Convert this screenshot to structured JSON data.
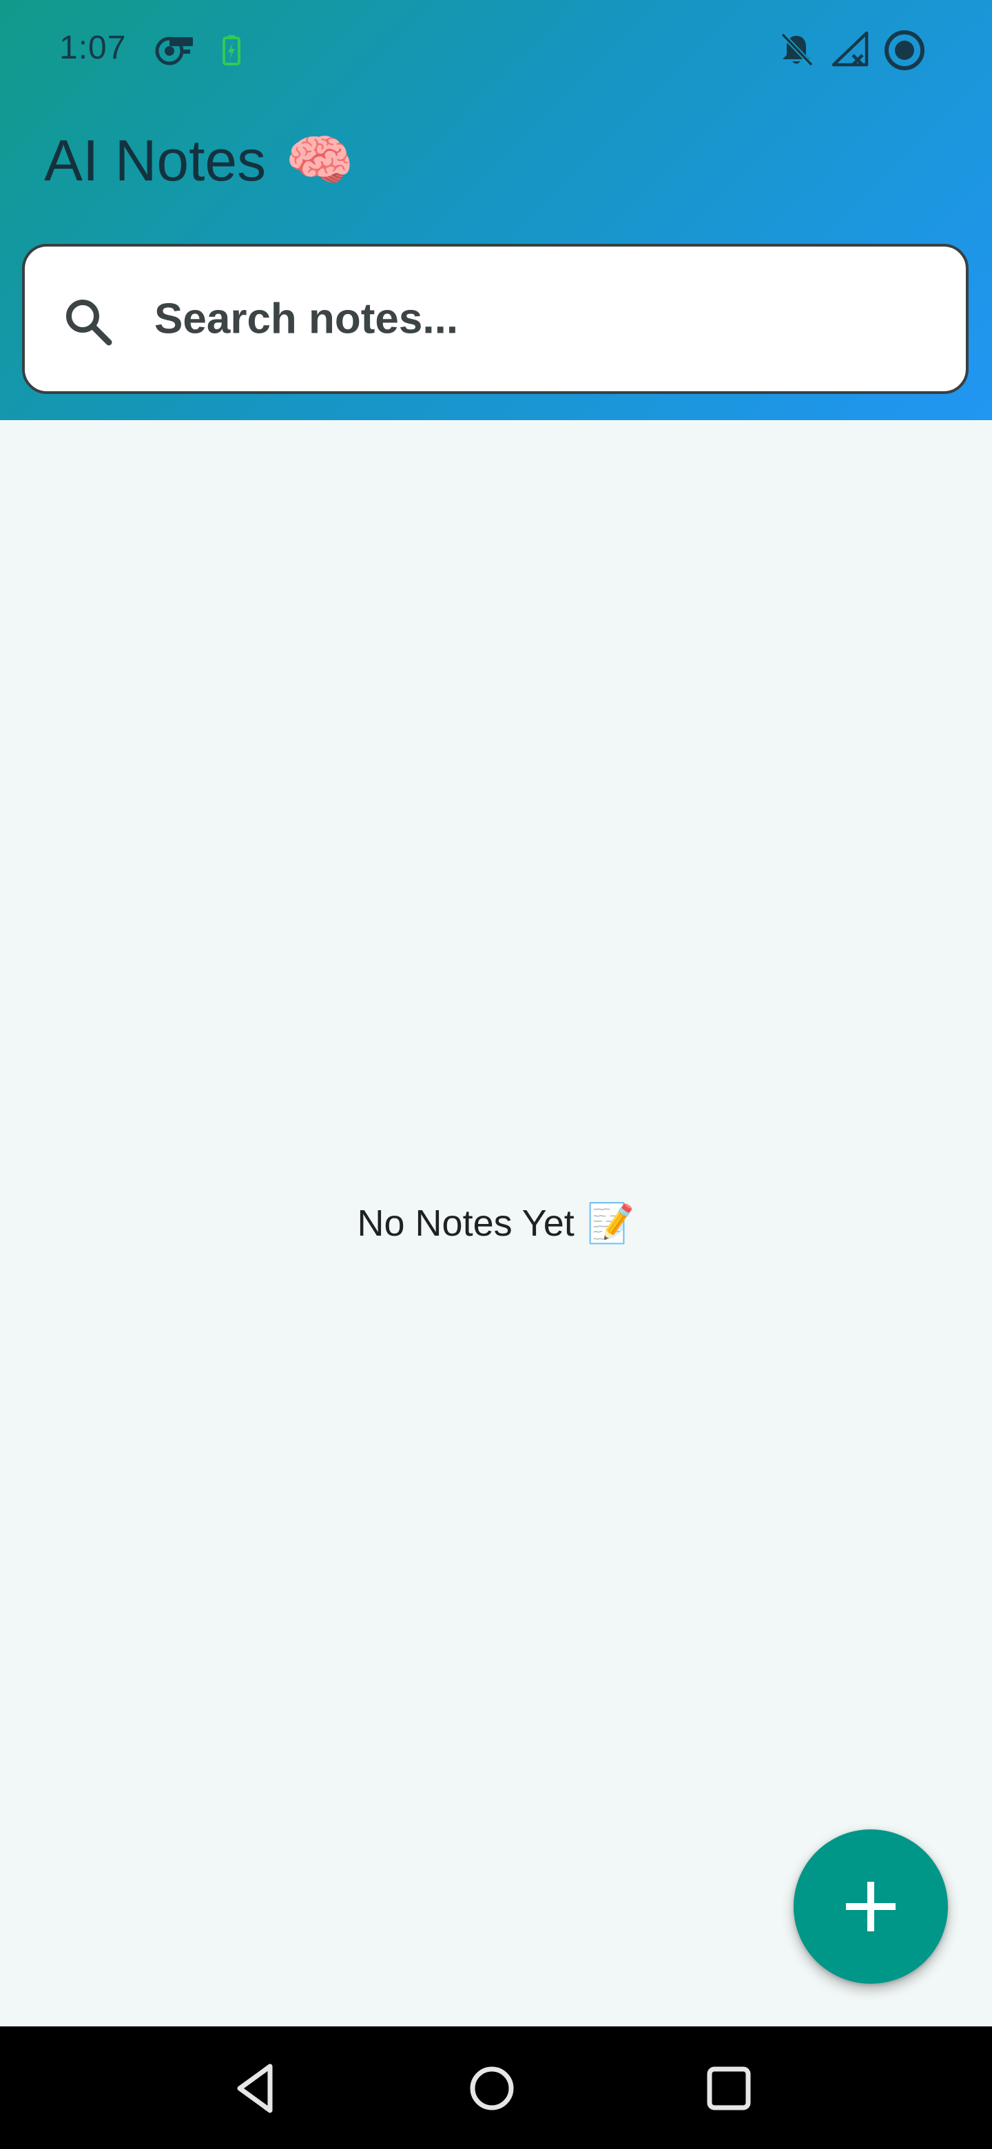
{
  "status_bar": {
    "time": "1:07",
    "icons": [
      "fan-speed-icon",
      "battery-charging-icon",
      "notifications-off-icon",
      "no-signal-icon",
      "record-indicator-icon"
    ]
  },
  "header": {
    "title": "AI Notes",
    "title_emoji": "🧠"
  },
  "search": {
    "placeholder": "Search notes...",
    "value": "",
    "icon": "search-icon"
  },
  "empty_state": {
    "text": "No Notes Yet",
    "emoji": "📝"
  },
  "fab": {
    "icon": "plus-icon",
    "color": "#009688"
  },
  "nav_bar": {
    "buttons": [
      "back-icon",
      "home-icon",
      "recents-icon"
    ]
  },
  "colors": {
    "header_gradient_start": "#119a8a",
    "header_gradient_end": "#2196f3",
    "background": "#f2f8f7",
    "accent": "#009688"
  }
}
